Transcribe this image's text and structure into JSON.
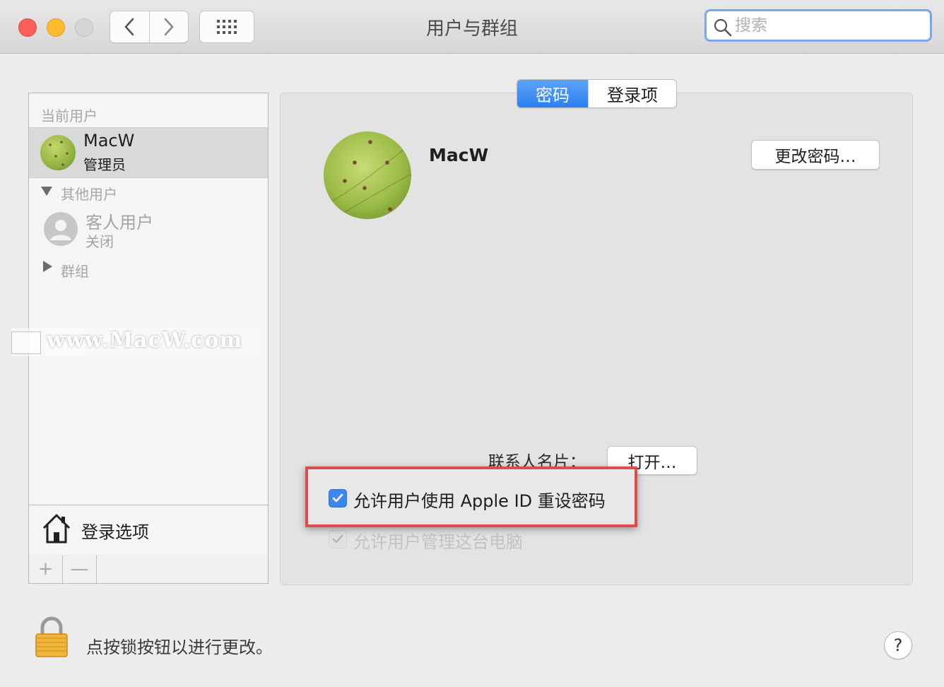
{
  "window": {
    "title": "用户与群组"
  },
  "search": {
    "placeholder": "搜索"
  },
  "sidebar": {
    "current_header": "当前用户",
    "current_user": {
      "name": "MacW",
      "role": "管理员"
    },
    "other_header": "其他用户",
    "guest": {
      "name": "客人用户",
      "status": "关闭"
    },
    "groups_label": "群组",
    "login_options": "登录选项",
    "add_label": "+",
    "remove_label": "—"
  },
  "watermark": {
    "text": "www.MacW.com"
  },
  "tabs": [
    {
      "label": "密码",
      "active": true
    },
    {
      "label": "登录项",
      "active": false
    }
  ],
  "main": {
    "user_name": "MacW",
    "change_password_label": "更改密码…",
    "contact_card_label": "联系人名片：",
    "open_button_label": "打开…",
    "checkbox_apple_id": {
      "label": "允许用户使用 Apple ID 重设密码",
      "checked": true
    },
    "checkbox_admin": {
      "label": "允许用户管理这台电脑",
      "checked": true,
      "disabled": true
    }
  },
  "footer": {
    "lock_text": "点按锁按钮以进行更改。",
    "help_label": "?"
  },
  "colors": {
    "accent": "#2a7ff0",
    "highlight": "#e04b4b"
  }
}
